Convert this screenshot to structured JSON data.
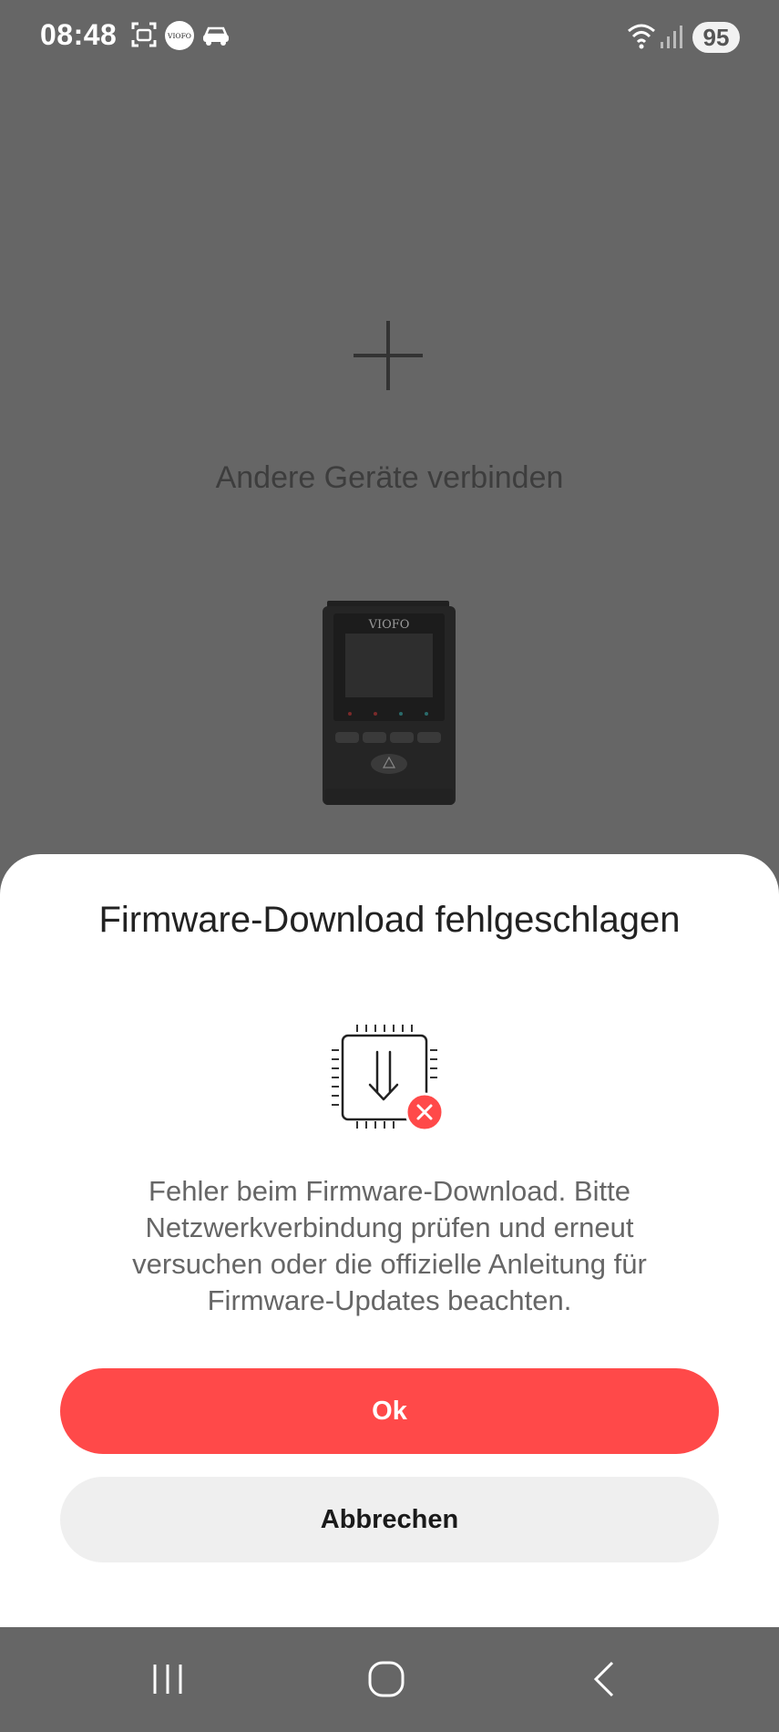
{
  "status_bar": {
    "time": "08:48",
    "battery": "95",
    "left_icons": [
      "screenshot-icon",
      "viofo-app-icon",
      "car-icon"
    ],
    "right_icons": [
      "wifi-icon",
      "signal-icon"
    ]
  },
  "background": {
    "add_device_label": "Andere Geräte verbinden",
    "camera_brand": "VIOFO"
  },
  "dialog": {
    "title": "Firmware-Download fehlgeschlagen",
    "message": "Fehler beim Firmware-Download. Bitte Netzwerkverbindung prüfen und erneut versuchen oder die offizielle Anleitung für Firmware-Updates beachten.",
    "ok_label": "Ok",
    "cancel_label": "Abbrechen"
  },
  "colors": {
    "accent": "#ff4949",
    "scrim": "#666666",
    "sheet": "#ffffff",
    "cancel_bg": "#efefef"
  },
  "nav_bar": {
    "buttons": [
      "recent-apps-icon",
      "home-icon",
      "back-icon"
    ]
  }
}
